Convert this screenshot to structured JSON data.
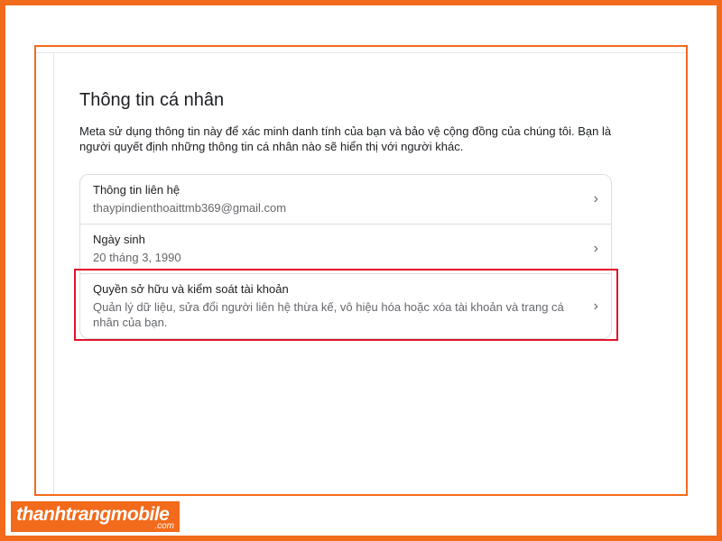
{
  "page": {
    "title": "Thông tin cá nhân",
    "description": "Meta sử dụng thông tin này để xác minh danh tính của bạn và bảo vệ cộng đồng của chúng tôi. Bạn là người quyết định những thông tin cá nhân nào sẽ hiển thị với người khác."
  },
  "items": [
    {
      "title": "Thông tin liên hệ",
      "subtitle": "thaypindienthoaittmb369@gmail.com",
      "chevron": "›"
    },
    {
      "title": "Ngày sinh",
      "subtitle": "20 tháng 3, 1990",
      "chevron": "›"
    },
    {
      "title": "Quyền sở hữu và kiểm soát tài khoản",
      "subtitle": "Quản lý dữ liệu, sửa đổi người liên hệ thừa kế, vô hiệu hóa hoặc xóa tài khoản và trang cá nhân của bạn.",
      "chevron": "›"
    }
  ],
  "brand": {
    "name": "thanhtrangmobile",
    "suffix": ".com"
  },
  "colors": {
    "frame": "#f26a1b",
    "highlight": "#e0142c"
  },
  "icons": {
    "chevron": "chevron-right-icon"
  }
}
